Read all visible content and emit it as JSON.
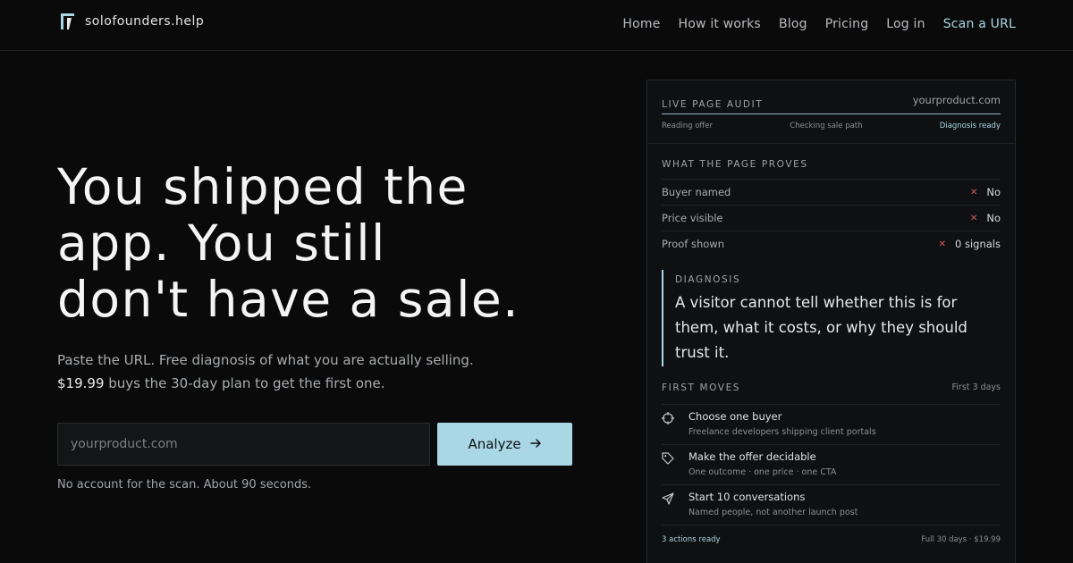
{
  "brand": {
    "name": "solofounders.help",
    "logo_icon": "bracket-logo-icon"
  },
  "nav": {
    "items": [
      {
        "label": "Home"
      },
      {
        "label": "How it works"
      },
      {
        "label": "Blog"
      },
      {
        "label": "Pricing"
      },
      {
        "label": "Log in"
      },
      {
        "label": "Scan a URL"
      }
    ]
  },
  "hero": {
    "title_line1": "You shipped the",
    "title_line2": "app. You still",
    "title_line3": "don't have a sale.",
    "sub_part1": "Paste the URL. Free diagnosis of what you are actually selling. ",
    "sub_price": "$19.99",
    "sub_part2": " buys the 30-day plan to get the first one.",
    "input_placeholder": "yourproduct.com",
    "button_label": "Analyze",
    "note": "No account for the scan. About 90 seconds."
  },
  "audit": {
    "title": "LIVE PAGE AUDIT",
    "domain": "yourproduct.com",
    "steps": [
      {
        "label": "Reading offer"
      },
      {
        "label": "Checking sale path"
      },
      {
        "label": "Diagnosis ready"
      }
    ],
    "proves_title": "WHAT THE PAGE PROVES",
    "proofs": [
      {
        "label": "Buyer named",
        "value": "No"
      },
      {
        "label": "Price visible",
        "value": "No"
      },
      {
        "label": "Proof shown",
        "value": "0 signals"
      }
    ],
    "diagnosis_label": "DIAGNOSIS",
    "diagnosis_text": "A visitor cannot tell whether this is for them, what it costs, or why they should trust it.",
    "moves_title": "FIRST MOVES",
    "moves_days": "First 3 days",
    "moves": [
      {
        "icon": "crosshair-icon",
        "title": "Choose one buyer",
        "sub": "Freelance developers shipping client portals"
      },
      {
        "icon": "tag-icon",
        "title": "Make the offer decidable",
        "sub": "One outcome · one price · one CTA"
      },
      {
        "icon": "send-icon",
        "title": "Start 10 conversations",
        "sub": "Named people, not another launch post"
      }
    ],
    "footer_ready": "3 actions ready",
    "footer_plan": "Full 30 days · $19.99"
  },
  "colors": {
    "background": "#0a0a0b",
    "accent": "#a9d7e4",
    "negative": "#d35a5a"
  }
}
